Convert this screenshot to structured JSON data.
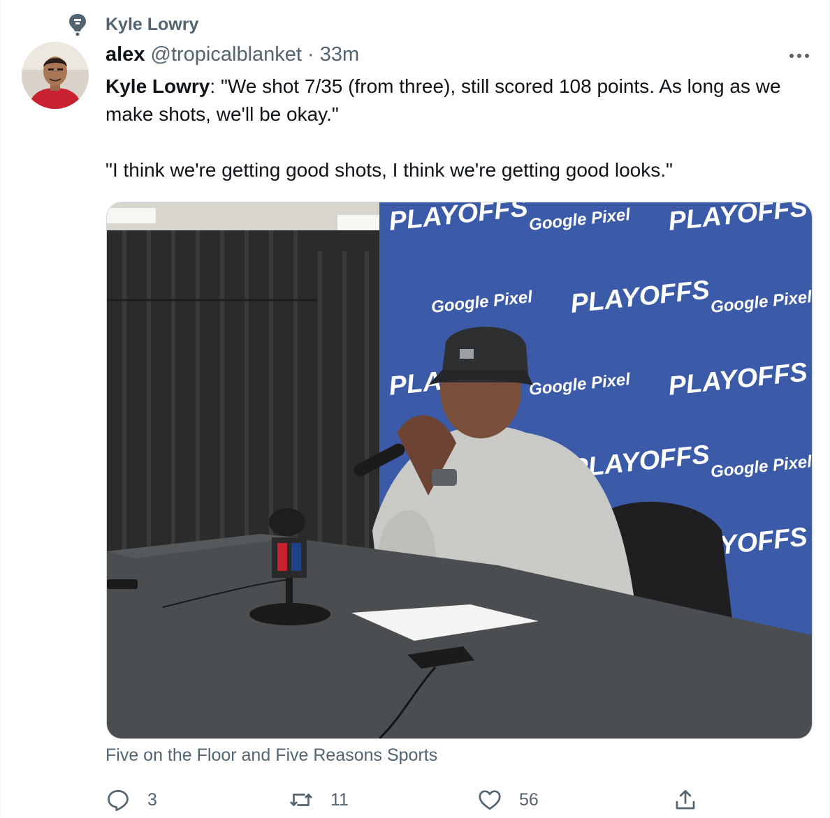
{
  "social_context": {
    "label": "Kyle Lowry",
    "icon": "topic-pin-icon"
  },
  "author": {
    "name": "alex",
    "handle": "@tropicalblanket",
    "separator": "·",
    "time": "33m"
  },
  "tweet": {
    "lead": "Kyle Lowry",
    "line1_rest": ": \"We shot 7/35 (from three), still scored 108 points. As long as we make shots, we'll be okay.\"",
    "line2": "\"I think we're getting good shots, I think we're getting good looks.\""
  },
  "media": {
    "backdrop_tiles": [
      "PLAYOFFS",
      "Google Pixel",
      "PLAYOFFS",
      "Google Pixel",
      "PLAYOFFS",
      "Google Pixel",
      "PLAYOFFS",
      "Google Pixel",
      "PLAYOFFS",
      "Google Pixel",
      "PLAYOFFS",
      "Google Pixel",
      "PLAYOFFS",
      "Google Pixel",
      "PLAYOFFS"
    ],
    "colors": {
      "backdrop": "#3b5aa8",
      "curtain": "#2b2b2b",
      "table": "#4b4e50",
      "hoodie": "#c9c9c6"
    }
  },
  "caption": "Five on the Floor and Five Reasons Sports",
  "actions": {
    "replies": "3",
    "retweets": "11",
    "likes": "56"
  },
  "colors": {
    "secondary_text": "#536471",
    "primary_text": "#0f1419"
  }
}
